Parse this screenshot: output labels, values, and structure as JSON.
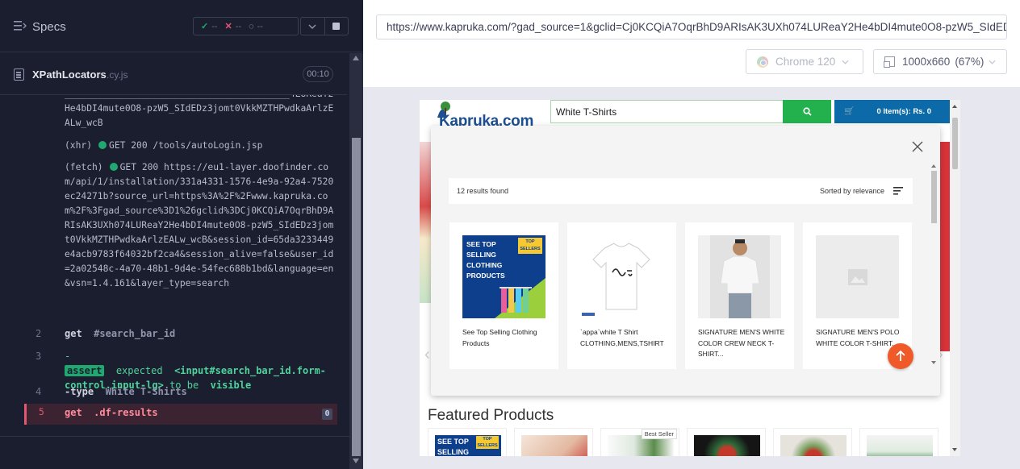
{
  "runner": {
    "specs_label": "Specs",
    "stats": {
      "passed": "--",
      "failed": "--",
      "pending": "--"
    },
    "file": {
      "name": "XPathLocators",
      "ext": ".cy.js",
      "duration": "00:10"
    },
    "log": {
      "block1_lines": "_________________________________________4LUReaY2He4bDI4mute0O8-pzW5_SIdEDz3jomt0VkkMZTHPwdkaArlzEALw_wcB",
      "xhr_tag": "(xhr)",
      "xhr_text": "GET 200 /tools/autoLogin.jsp",
      "fetch_tag": "(fetch)",
      "fetch_text": "GET 200 https://eu1-layer.doofinder.com/api/1/installation/331a4331-1576-4e9a-92a4-7520ec24271b?source_url=https%3A%2F%2Fwww.kapruka.com%2F%3Fgad_source%3D1%26gclid%3DCj0KCQiA7OqrBhD9ARIsAK3UXh074LUReaY2He4bDI4mute0O8-pzW5_SIdEDz3jomt0VkkMZTHPwdkaArlzEALw_wcB&session_id=65da3233449e4acb9783f64032bf2ca4&session_alive=false&user_id=2a02548c-4a70-48b1-9d4e-54fec688b1bd&language=en&vsn=1.4.161&layer_type=search",
      "commands": [
        {
          "num": "2",
          "name": "get",
          "arg": "#search_bar_id"
        },
        {
          "num": "3",
          "prefix": "-",
          "badge": "assert",
          "expected": "expected",
          "subject": "<input#search_bar_id.form-control.input-lg>",
          "to_be": "to be",
          "visible": "visible"
        },
        {
          "num": "4",
          "name": "-type",
          "arg": "White T-Shirts"
        },
        {
          "num": "5",
          "name": "get",
          "arg": ".df-results",
          "count": "0"
        }
      ]
    }
  },
  "browser": {
    "url": "https://www.kapruka.com/?gad_source=1&gclid=Cj0KCQiA7OqrBhD9ARIsAK3UXh074LUReaY2He4bDI4mute0O8-pzW5_SIdEDz3jomt0VkkMZTHPwdkaArlzEALw_wcB",
    "browser_name": "Chrome 120",
    "viewport": "1000x660",
    "zoom": "(67%)"
  },
  "aut": {
    "logo": "Kapruka.com",
    "search_value": "White T-Shirts",
    "cart": "0 Item(s): Rs. 0",
    "results_count": "12 results found",
    "sort_label": "Sorted by relevance",
    "promo_text": "SEE TOP SELLING CLOTHING PRODUCTS",
    "promo_tag": "TOP SELLERS",
    "products": [
      {
        "title": "See Top Selling Clothing Products"
      },
      {
        "title": "`appa`white T Shirt CLOTHING,MENS,TSHIRT"
      },
      {
        "title": "SIGNATURE MEN'S WHITE COLOR CREW NECK T-SHIRT..."
      },
      {
        "title": "SIGNATURE MEN'S POLO WHITE COLOR T-SHIRT..."
      }
    ],
    "featured_title": "Featured Products",
    "best_seller": "Best Seller",
    "feat_promo_text": "SEE TOP SELLING"
  },
  "colors": {
    "pass": "#1fa971",
    "fail": "#e45770",
    "search_green": "#23b14d",
    "cart_blue": "#0b6aa7",
    "fab": "#f05a28"
  }
}
